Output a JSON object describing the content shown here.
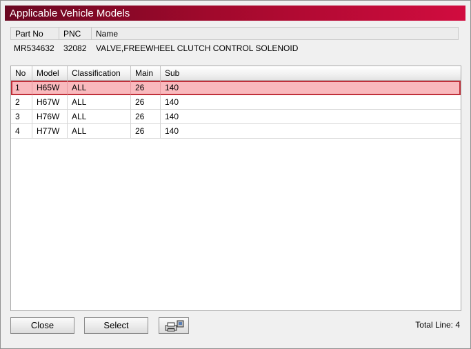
{
  "window": {
    "title": "Applicable Vehicle Models"
  },
  "part": {
    "headers": [
      "Part No",
      "PNC",
      "Name"
    ],
    "part_no": "MR534632",
    "pnc": "32082",
    "name": "VALVE,FREEWHEEL CLUTCH CONTROL SOLENOID"
  },
  "table": {
    "columns": [
      "No",
      "Model",
      "Classification",
      "Main",
      "Sub"
    ],
    "rows": [
      {
        "no": "1",
        "model": "H65W",
        "classification": "ALL",
        "main": "26",
        "sub": "140",
        "selected": true
      },
      {
        "no": "2",
        "model": "H67W",
        "classification": "ALL",
        "main": "26",
        "sub": "140",
        "selected": false
      },
      {
        "no": "3",
        "model": "H76W",
        "classification": "ALL",
        "main": "26",
        "sub": "140",
        "selected": false
      },
      {
        "no": "4",
        "model": "H77W",
        "classification": "ALL",
        "main": "26",
        "sub": "140",
        "selected": false
      }
    ]
  },
  "buttons": {
    "close": "Close",
    "select": "Select",
    "print_icon": "printer-icon"
  },
  "footer": {
    "total_line": "Total Line: 4"
  },
  "colors": {
    "title_bar_start": "#6a0721",
    "title_bar_end": "#d10c3f",
    "selected_row_bg": "#f9b9bd",
    "selected_row_border": "#c0303a"
  }
}
